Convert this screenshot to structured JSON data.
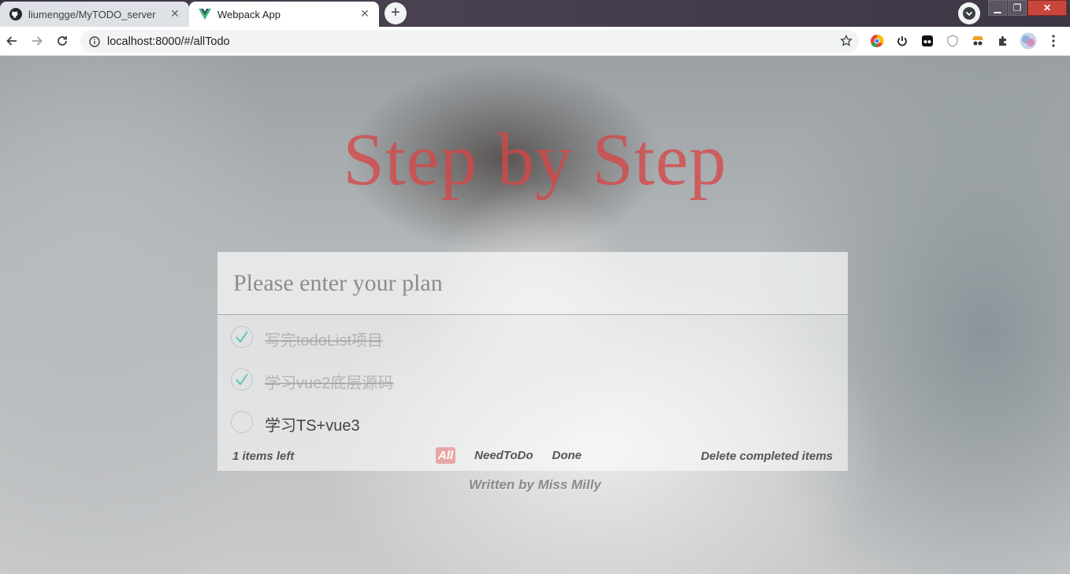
{
  "browser": {
    "tabs": [
      {
        "title": "liumengge/MyTODO_server",
        "icon": "github-icon",
        "active": false
      },
      {
        "title": "Webpack App",
        "icon": "vue-icon",
        "active": true
      }
    ],
    "url": "localhost:8000/#/allTodo"
  },
  "app": {
    "title": "Step by Step",
    "input_placeholder": "Please enter your plan",
    "todos": [
      {
        "text": "写完todoList项目",
        "completed": true
      },
      {
        "text": "学习vue2底层源码",
        "completed": true
      },
      {
        "text": "学习TS+vue3",
        "completed": false
      }
    ],
    "items_left": "1 items left",
    "filters": [
      "All",
      "NeedToDo",
      "Done"
    ],
    "active_filter": "All",
    "clear_label": "Delete completed items",
    "credit": "Written by Miss Milly"
  },
  "colors": {
    "title": "#d64646",
    "check": "#5dc2af",
    "active_filter": "#e66e6e"
  }
}
